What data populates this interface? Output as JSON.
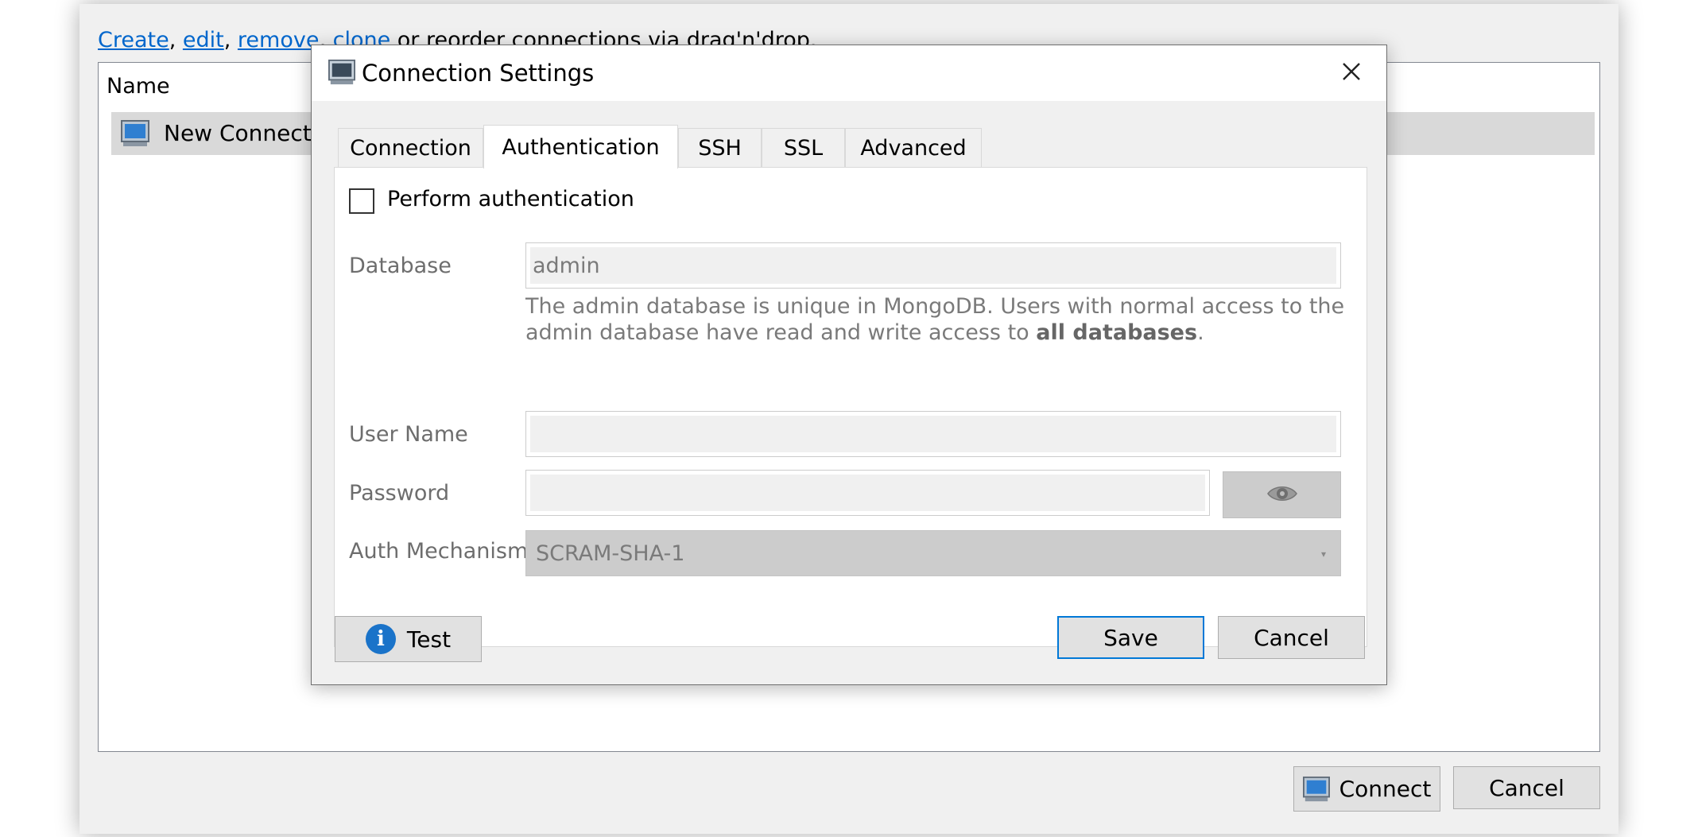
{
  "background": {
    "hint": {
      "links": [
        "Create",
        "edit",
        "remove",
        "clone"
      ],
      "separator": ", ",
      "rest": " or reorder connections via drag'n'drop."
    },
    "list": {
      "column_header": "Name",
      "rows": [
        {
          "label": "New Connection",
          "icon": "monitor-icon"
        }
      ]
    },
    "buttons": {
      "connect": "Connect",
      "cancel": "Cancel"
    }
  },
  "dialog": {
    "title": "Connection Settings",
    "title_icon": "monitor-icon",
    "close_icon": "close-icon",
    "tabs": [
      {
        "label": "Connection",
        "active": false
      },
      {
        "label": "Authentication",
        "active": true
      },
      {
        "label": "SSH",
        "active": false
      },
      {
        "label": "SSL",
        "active": false
      },
      {
        "label": "Advanced",
        "active": false
      }
    ],
    "auth": {
      "perform_auth_label": "Perform authentication",
      "perform_auth_checked": false,
      "database_label": "Database",
      "database_value": "admin",
      "description_prefix": "The admin database is unique in MongoDB. Users with normal access to the admin database have read and write access to ",
      "description_bold": "all databases",
      "description_suffix": ".",
      "username_label": "User Name",
      "username_value": "",
      "password_label": "Password",
      "password_value": "",
      "password_toggle_icon": "eye-icon",
      "mechanism_label": "Auth Mechanism",
      "mechanism_value": "SCRAM-SHA-1"
    },
    "buttons": {
      "test": "Test",
      "save": "Save",
      "cancel": "Cancel"
    }
  },
  "colors": {
    "link": "#0066cc",
    "selected_row": "#d9d9d9",
    "default_button_border": "#0078d7",
    "info_icon": "#1a73c9"
  }
}
